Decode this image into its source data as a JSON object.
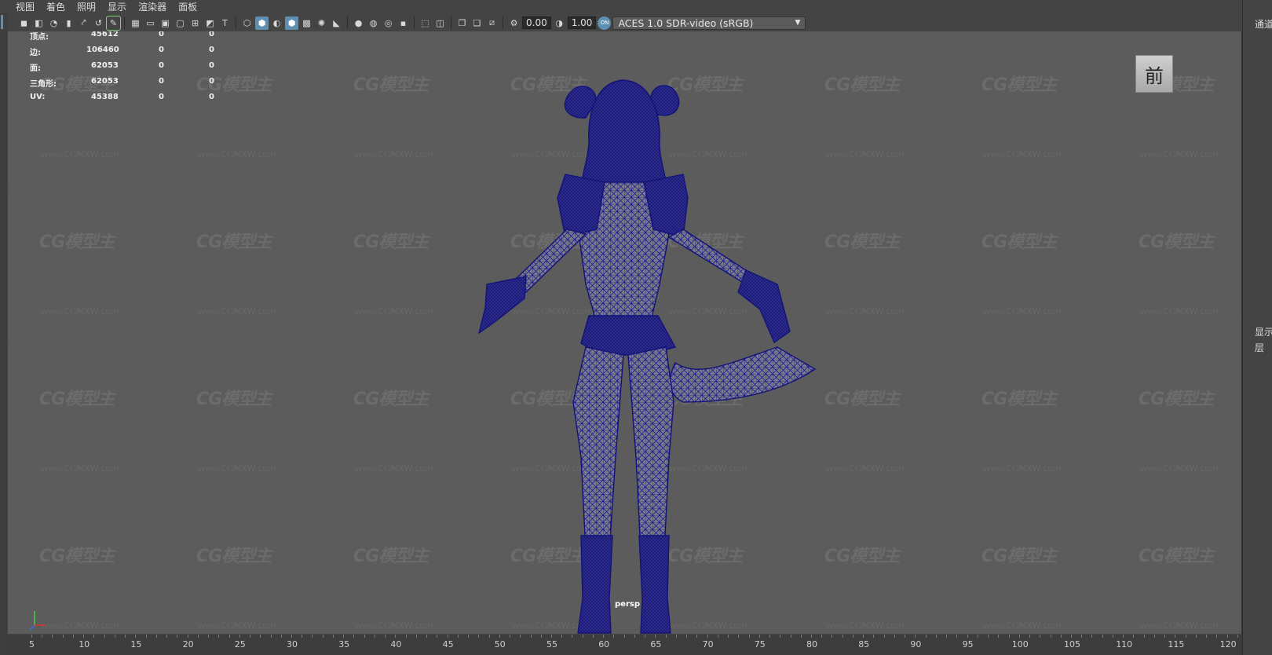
{
  "menu": [
    "视图",
    "着色",
    "照明",
    "显示",
    "渲染器",
    "面板"
  ],
  "toolbar": {
    "exposure_value": "0.00",
    "gamma_value": "1.00",
    "color_space": "ACES 1.0 SDR-video (sRGB)",
    "color_management_badge": "ON"
  },
  "hud": {
    "rows": [
      {
        "label": "顶点:",
        "count": "45612",
        "sel1": "0",
        "sel2": "0"
      },
      {
        "label": "边:",
        "count": "106460",
        "sel1": "0",
        "sel2": "0"
      },
      {
        "label": "面:",
        "count": "62053",
        "sel1": "0",
        "sel2": "0"
      },
      {
        "label": "三角形:",
        "count": "62053",
        "sel1": "0",
        "sel2": "0"
      },
      {
        "label": "UV:",
        "count": "45388",
        "sel1": "0",
        "sel2": "0"
      }
    ]
  },
  "viewcube_label": "前",
  "camera_label": "persp",
  "watermark": {
    "logo": "CG模型主",
    "url": "www.CGMXW.com"
  },
  "timeline": {
    "ticks": [
      "5",
      "10",
      "15",
      "20",
      "25",
      "30",
      "35",
      "40",
      "45",
      "50",
      "55",
      "60",
      "65",
      "70",
      "75",
      "80",
      "85",
      "90",
      "95",
      "100",
      "105",
      "110",
      "115",
      "120"
    ]
  },
  "right_panel": {
    "channels_label": "通道",
    "display_label": "显示",
    "layers_label": "层"
  },
  "colors": {
    "viewport_bg": "#5c5c5c",
    "wireframe": "#1a1a8c",
    "ui_bg": "#444444",
    "highlight": "#5f8fb0"
  },
  "toolbar_icons": [
    "camera-select-icon",
    "camera-attributes-icon",
    "bookmark-icon",
    "image-plane-icon",
    "2d-pan-icon",
    "grease-pencil-icon",
    "grid-icon",
    "film-gate-icon",
    "resolution-gate-icon",
    "gate-mask-icon",
    "field-chart-icon",
    "safe-action-icon",
    "safe-title-icon",
    "wireframe-icon",
    "smooth-shade-icon",
    "default-material-icon",
    "textured-icon",
    "use-all-lights-icon",
    "shadows-icon",
    "screen-space-ao-icon",
    "motion-blur-icon",
    "multisample-aa-icon",
    "depth-of-field-icon",
    "isolate-select-icon",
    "xray-icon",
    "xray-joints-icon",
    "backface-culling-icon",
    "exposure-icon",
    "gamma-icon",
    "color-management-icon"
  ]
}
